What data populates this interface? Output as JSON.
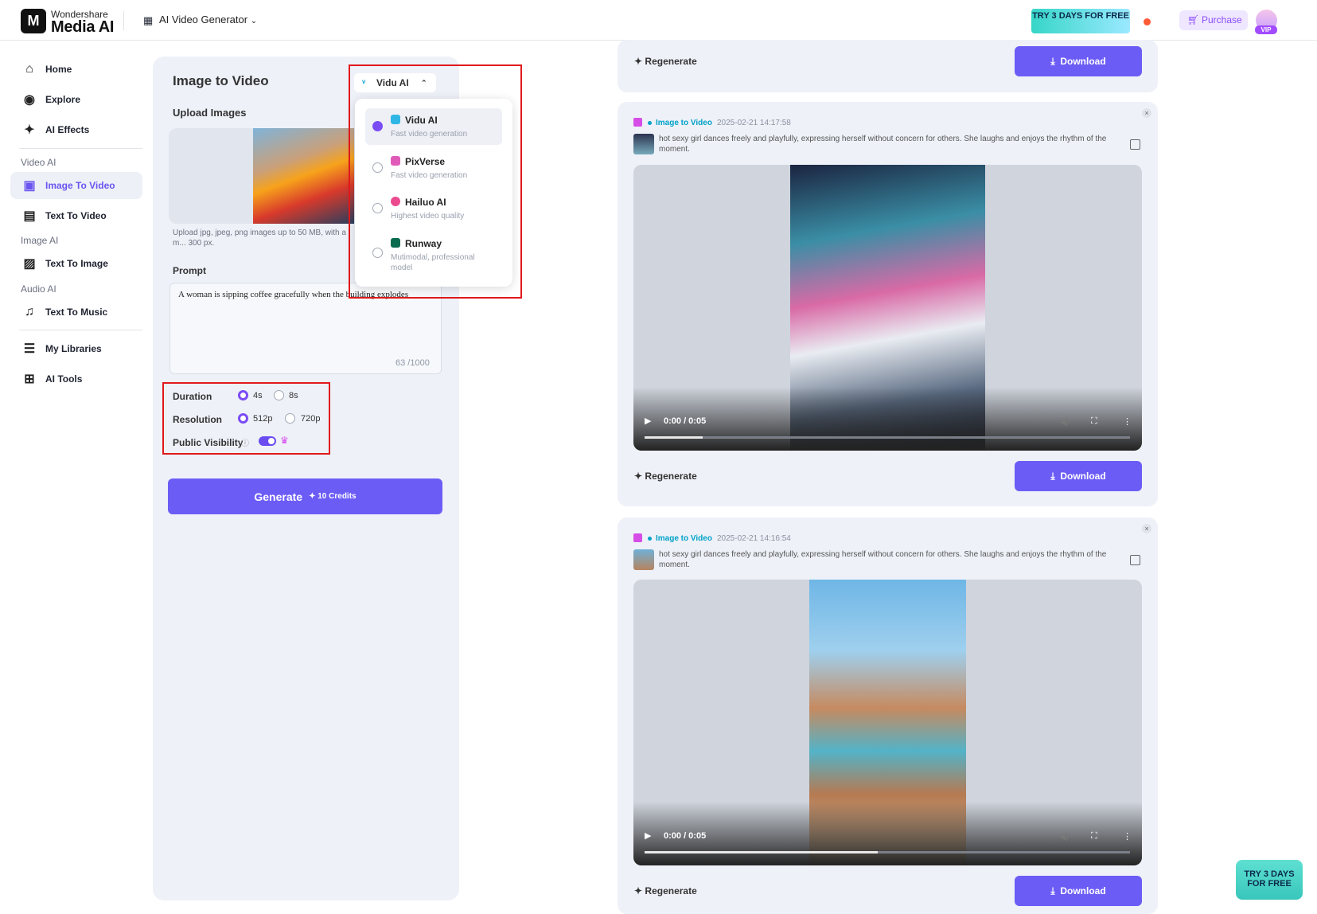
{
  "header": {
    "brand_top": "Wondershare",
    "brand_name": "Media AI",
    "product": "AI Video Generator",
    "promo": "TRY 3 DAYS FOR FREE",
    "purchase": "Purchase",
    "vip": "VIP"
  },
  "sidebar": {
    "home": "Home",
    "explore": "Explore",
    "ai_effects": "AI Effects",
    "sec_video": "Video AI",
    "image_to_video": "Image To Video",
    "text_to_video": "Text To Video",
    "sec_image": "Image AI",
    "text_to_image": "Text To Image",
    "sec_audio": "Audio AI",
    "text_to_music": "Text To Music",
    "my_libraries": "My Libraries",
    "ai_tools": "AI Tools"
  },
  "panel": {
    "title": "Image to Video",
    "upload_label": "Upload Images",
    "upload_note": "Upload jpg, jpeg, png images up to 50 MB, with a m... 300 px.",
    "prompt_label": "Prompt",
    "prompt_value": "A woman is sipping coffee gracefully when the building explodes",
    "prompt_count": "63 /1000",
    "duration_label": "Duration",
    "dur_4": "4s",
    "dur_8": "8s",
    "resolution_label": "Resolution",
    "res_512": "512p",
    "res_720": "720p",
    "visibility_label": "Public Visibility",
    "generate": "Generate",
    "credits": "10 Credits"
  },
  "model_menu": {
    "current": "Vidu AI",
    "items": [
      {
        "name": "Vidu AI",
        "desc": "Fast video generation"
      },
      {
        "name": "PixVerse",
        "desc": "Fast video generation"
      },
      {
        "name": "Hailuo AI",
        "desc": "Highest video quality"
      },
      {
        "name": "Runway",
        "desc": "Mutimodal, professional model"
      }
    ]
  },
  "cards": {
    "regenerate": "Regenerate",
    "download": "Download",
    "c1": {
      "tag": "Image to Video",
      "date": "2025-02-21 14:17:58",
      "desc": "hot sexy girl dances freely and playfully, expressing herself without concern for others. She laughs and enjoys the rhythm of the moment.",
      "time": "0:00 / 0:05",
      "progress": 0.12
    },
    "c2": {
      "tag": "Image to Video",
      "date": "2025-02-21 14:16:54",
      "desc": "hot sexy girl dances freely and playfully, expressing herself without concern for others. She laughs and enjoys the rhythm of the moment.",
      "time": "0:00 / 0:05",
      "progress": 0.48
    }
  }
}
